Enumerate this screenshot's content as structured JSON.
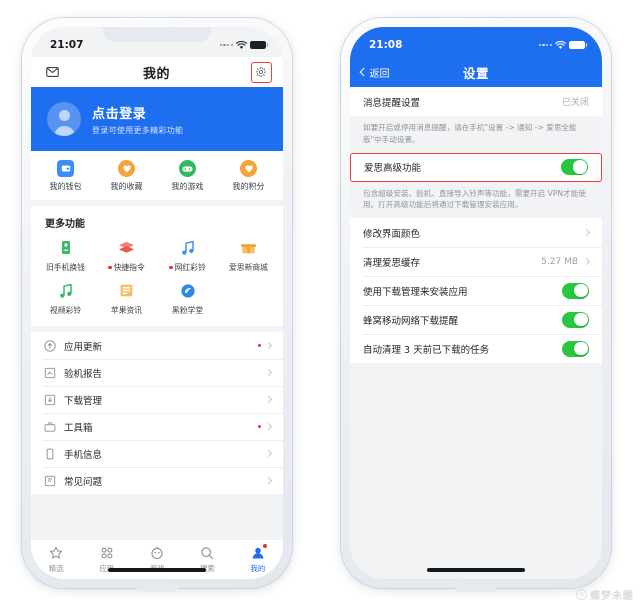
{
  "left_phone": {
    "status_bar": {
      "time": "21:07"
    },
    "nav": {
      "title": "我的",
      "mail_icon": "mail-icon",
      "settings_icon": "gear-icon"
    },
    "login_banner": {
      "title": "点击登录",
      "subtitle": "登录可使用更多精彩功能"
    },
    "quick_items": [
      {
        "label": "我的钱包",
        "icon": "wallet-icon",
        "color": "#2f7bf0"
      },
      {
        "label": "我的收藏",
        "icon": "heart-icon",
        "color": "#f5a33a"
      },
      {
        "label": "我的游戏",
        "icon": "gamepad-icon",
        "color": "#34b961"
      },
      {
        "label": "我的积分",
        "icon": "points-icon",
        "color": "#f5a33a"
      }
    ],
    "more_section": {
      "title": "更多功能",
      "items": [
        {
          "label": "旧手机换钱",
          "icon": "old-phone-icon",
          "color": "#37b86a",
          "dot": false
        },
        {
          "label": "快捷指令",
          "icon": "shortcuts-icon",
          "color": "#e8564e",
          "dot": true
        },
        {
          "label": "网红彩铃",
          "icon": "music-note-icon",
          "color": "#3f8ef5",
          "dot": true
        },
        {
          "label": "爱思新商城",
          "icon": "shop-icon",
          "color": "#f0a533",
          "dot": false
        },
        {
          "label": "视频彩铃",
          "icon": "video-music-icon",
          "color": "#37b86a",
          "dot": false
        },
        {
          "label": "苹果资讯",
          "icon": "news-icon",
          "color": "#f0a533",
          "dot": false
        },
        {
          "label": "黑粉学堂",
          "icon": "classroom-icon",
          "color": "#2f87e8",
          "dot": false
        }
      ]
    },
    "menu_rows": [
      {
        "label": "应用更新",
        "icon": "update-icon",
        "dot": true
      },
      {
        "label": "验机报告",
        "icon": "report-icon",
        "dot": false
      },
      {
        "label": "下载管理",
        "icon": "download-icon",
        "dot": false
      },
      {
        "label": "工具箱",
        "icon": "toolbox-icon",
        "dot": true
      },
      {
        "label": "手机信息",
        "icon": "phone-info-icon",
        "dot": false
      },
      {
        "label": "常见问题",
        "icon": "faq-icon",
        "dot": false
      }
    ],
    "tabs": [
      {
        "label": "精选",
        "icon": "star-icon",
        "active": false,
        "dot": false
      },
      {
        "label": "应用",
        "icon": "apps-grid-icon",
        "active": false,
        "dot": false
      },
      {
        "label": "游戏",
        "icon": "game-face-icon",
        "active": false,
        "dot": false
      },
      {
        "label": "搜索",
        "icon": "search-icon",
        "active": false,
        "dot": false
      },
      {
        "label": "我的",
        "icon": "user-icon",
        "active": true,
        "dot": true
      }
    ]
  },
  "right_phone": {
    "status_bar": {
      "time": "21:08"
    },
    "nav": {
      "back_label": "返回",
      "title": "设置",
      "back_icon": "chevron-left-icon"
    },
    "notify_row": {
      "label": "消息提醒设置",
      "value": "已关闭"
    },
    "notify_desc": "如要开启或停用消息提醒，请在手机\"设置 -> 通知 -> 爱思全能版\"中手动设置。",
    "advanced_row": {
      "label": "爱思高级功能",
      "toggle": "on",
      "highlighted": true
    },
    "advanced_desc": "包含超级安装、验机、直接导入铃声等功能，需要开启 VPN才能使用。打开高级功能后将通过下载管理安装应用。",
    "settings_rows": [
      {
        "label": "修改界面颜色",
        "type": "chevron",
        "value": ""
      },
      {
        "label": "清理爱思缓存",
        "type": "chevron",
        "value": "5.27 MB"
      },
      {
        "label": "使用下载管理来安装应用",
        "type": "toggle",
        "toggle": "on"
      },
      {
        "label": "蜂窝移动网络下载提醒",
        "type": "toggle",
        "toggle": "on"
      },
      {
        "label": "自动清理 3 天前已下载的任务",
        "type": "toggle",
        "toggle": "on"
      }
    ]
  },
  "watermark": {
    "logo": "baidu-logo-icon",
    "text": "蝶梦未醒"
  },
  "colors": {
    "brand_blue": "#1e6ef0",
    "toggle_green": "#27c840",
    "highlight_red": "#e8403a",
    "badge_red": "#e8342c"
  }
}
